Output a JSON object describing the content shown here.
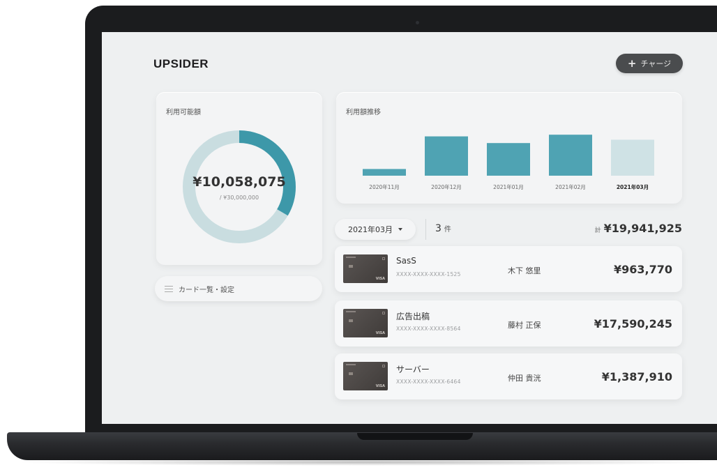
{
  "brand": {
    "logo": "UPSIDER"
  },
  "header": {
    "charge_label": "チャージ"
  },
  "available": {
    "title": "利用可能額",
    "amount": "¥10,058,075",
    "limit": "/ ¥30,000,000",
    "used_fraction": 0.335,
    "colors": {
      "remaining": "#c9dde0",
      "used": "#3d98a9"
    }
  },
  "card_list_button": {
    "label": "カード一覧・設定"
  },
  "trend": {
    "title": "利用額推移",
    "chart_data": {
      "type": "bar",
      "title": "利用額推移",
      "categories": [
        "2020年11月",
        "2020年12月",
        "2021年01月",
        "2021年02月",
        "2021年03月"
      ],
      "values": [
        8,
        47,
        39,
        49,
        43
      ],
      "colors": [
        "#4fa3b3",
        "#4fa3b3",
        "#4fa3b3",
        "#4fa3b3",
        "#cfe2e5"
      ],
      "selected_category": "2021年03月",
      "ylim": [
        0,
        50
      ]
    }
  },
  "filter": {
    "month": "2021年03月",
    "count": "3",
    "count_unit": "件",
    "total_label": "計",
    "total_amount": "¥19,941,925"
  },
  "transactions": [
    {
      "name": "SasS",
      "card_number": "XXXX-XXXX-XXXX-1525",
      "user": "木下 悠里",
      "amount": "¥963,770",
      "brand": "VISA"
    },
    {
      "name": "広告出稿",
      "card_number": "XXXX-XXXX-XXXX-8564",
      "user": "藤村 正保",
      "amount": "¥17,590,245",
      "brand": "VISA"
    },
    {
      "name": "サーバー",
      "card_number": "XXXX-XXXX-XXXX-6464",
      "user": "仲田 貴洸",
      "amount": "¥1,387,910",
      "brand": "VISA"
    }
  ]
}
